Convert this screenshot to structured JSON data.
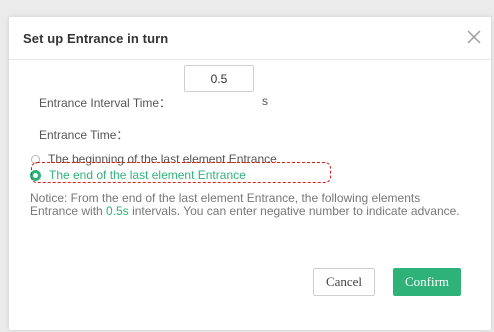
{
  "dialog": {
    "title": "Set up Entrance in turn",
    "close_icon": "close-icon"
  },
  "interval": {
    "label": "Entrance Interval Time：",
    "value": "0.5",
    "unit": "s"
  },
  "entrance_time": {
    "label": "Entrance Time：",
    "options": [
      {
        "label": "The beginning of the last element Entrance",
        "checked": false
      },
      {
        "label": "The end of the last element Entrance",
        "checked": true
      }
    ]
  },
  "notice": {
    "prefix": "Notice: From the end of the last element Entrance, the following elements Entrance with ",
    "value": "0.5s",
    "suffix": " intervals. You can enter negative number to indicate advance."
  },
  "buttons": {
    "cancel": "Cancel",
    "confirm": "Confirm"
  },
  "colors": {
    "accent": "#2fb27a",
    "highlight": "#d9211b"
  }
}
